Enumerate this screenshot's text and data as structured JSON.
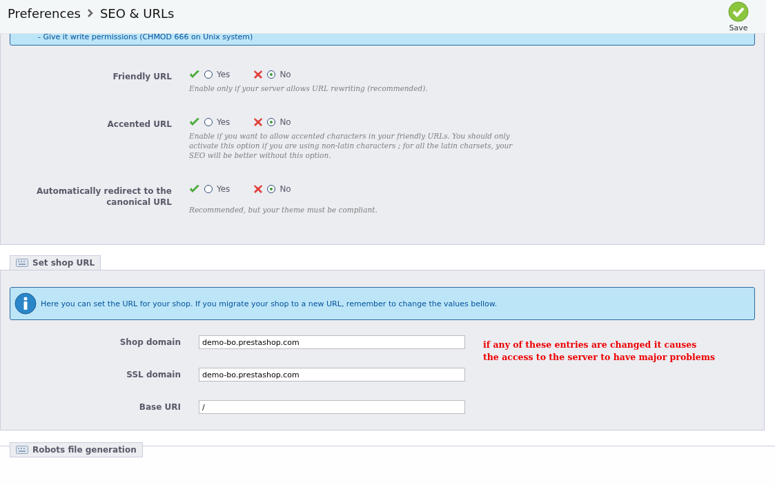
{
  "header": {
    "breadcrumb": [
      "Preferences",
      "SEO & URLs"
    ],
    "save_label": "Save"
  },
  "url_settings": {
    "info_lines": [
      "- Give it write permissions (CHMOD 666 on Unix system)"
    ],
    "options": [
      {
        "label": "Friendly URL",
        "yes": {
          "label": "Yes",
          "selected": false
        },
        "no": {
          "label": "No",
          "selected": true
        },
        "hint": "Enable only if your server allows URL rewriting (recommended)."
      },
      {
        "label": "Accented URL",
        "yes": {
          "label": "Yes",
          "selected": false
        },
        "no": {
          "label": "No",
          "selected": true
        },
        "hint": "Enable if you want to allow accented characters in your friendly URLs. You should only activate this option if you are using non-latin characters ; for all the latin charsets, your SEO will be better without this option."
      },
      {
        "label": "Automatically redirect to the canonical URL",
        "yes": {
          "label": "Yes",
          "selected": false
        },
        "no": {
          "label": "No",
          "selected": true
        },
        "hint": "Recommended, but your theme must be compliant."
      }
    ]
  },
  "shop_url": {
    "legend": "Set shop URL",
    "info": "Here you can set the URL for your shop. If you migrate your shop to a new URL, remember to change the values bellow.",
    "fields": [
      {
        "label": "Shop domain",
        "value": "demo-bo.prestashop.com"
      },
      {
        "label": "SSL domain",
        "value": "demo-bo.prestashop.com"
      },
      {
        "label": "Base URI",
        "value": "/"
      }
    ],
    "note": "if any of these entries are changed it causes\nthe access to the server to have major problems"
  },
  "robots": {
    "legend": "Robots file generation"
  }
}
